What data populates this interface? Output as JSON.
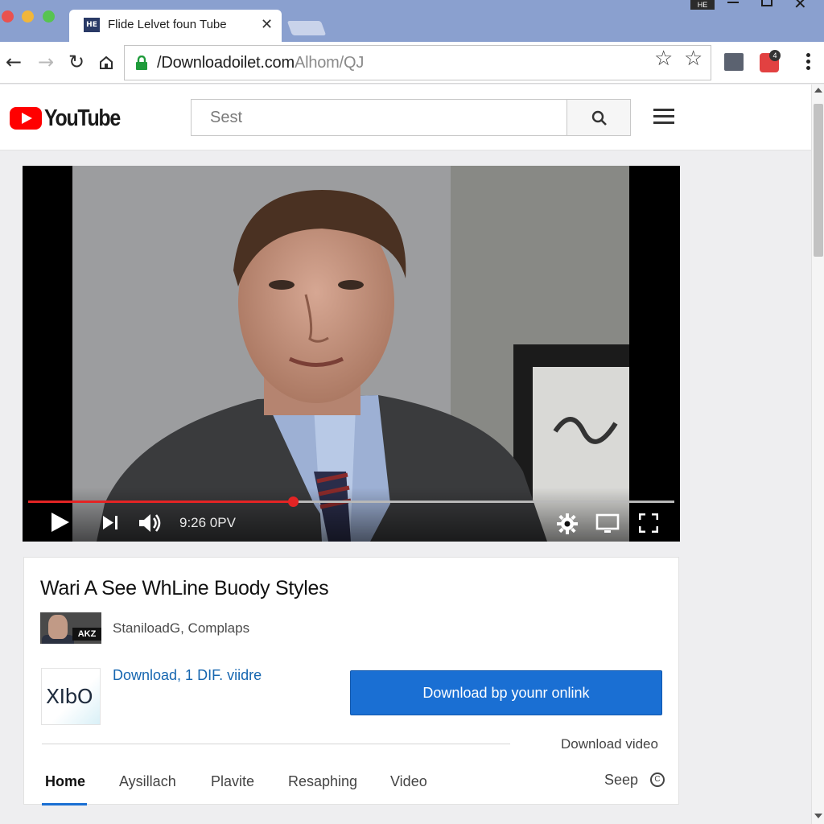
{
  "browser": {
    "tab_title": "Flide Lelvet foun Tube",
    "tab_favicon": "HE",
    "window_badge": "HE",
    "url_main": "/Downloadoilet.com",
    "url_rest": "Alhom/QJ",
    "icons": [
      "back-arrow-icon",
      "forward-arrow-icon",
      "reload-icon",
      "home-icon",
      "lock-icon",
      "star-icon",
      "bookmark-star-icon",
      "extension-icon",
      "notification-extension-icon",
      "kebab-menu-icon"
    ],
    "extension_badge": "4"
  },
  "youtube": {
    "logo_text": "YouTube",
    "search_placeholder": "Sest",
    "brand_color": "#ff0000"
  },
  "player": {
    "time": "9:26 0PV",
    "progress": 0.41,
    "progress_color": "#e32424"
  },
  "video": {
    "title": "Wari A See WhLine Buody Styles",
    "thumb_label": "AKZ",
    "channel": "StaniloadG, Complaps",
    "logo_text": "XIbO",
    "download_link": "Download, 1 DIF. viidre",
    "download_button": "Download bp younr onlink",
    "download_video": "Download video"
  },
  "tabs": {
    "items": [
      {
        "label": "Home",
        "active": true
      },
      {
        "label": "Aysillach"
      },
      {
        "label": "Plavite"
      },
      {
        "label": "Resaphing"
      },
      {
        "label": "Video"
      }
    ],
    "seep": "Seep"
  },
  "colors": {
    "accent": "#1a6fd3",
    "tabstrip": "#8aa0cf"
  }
}
